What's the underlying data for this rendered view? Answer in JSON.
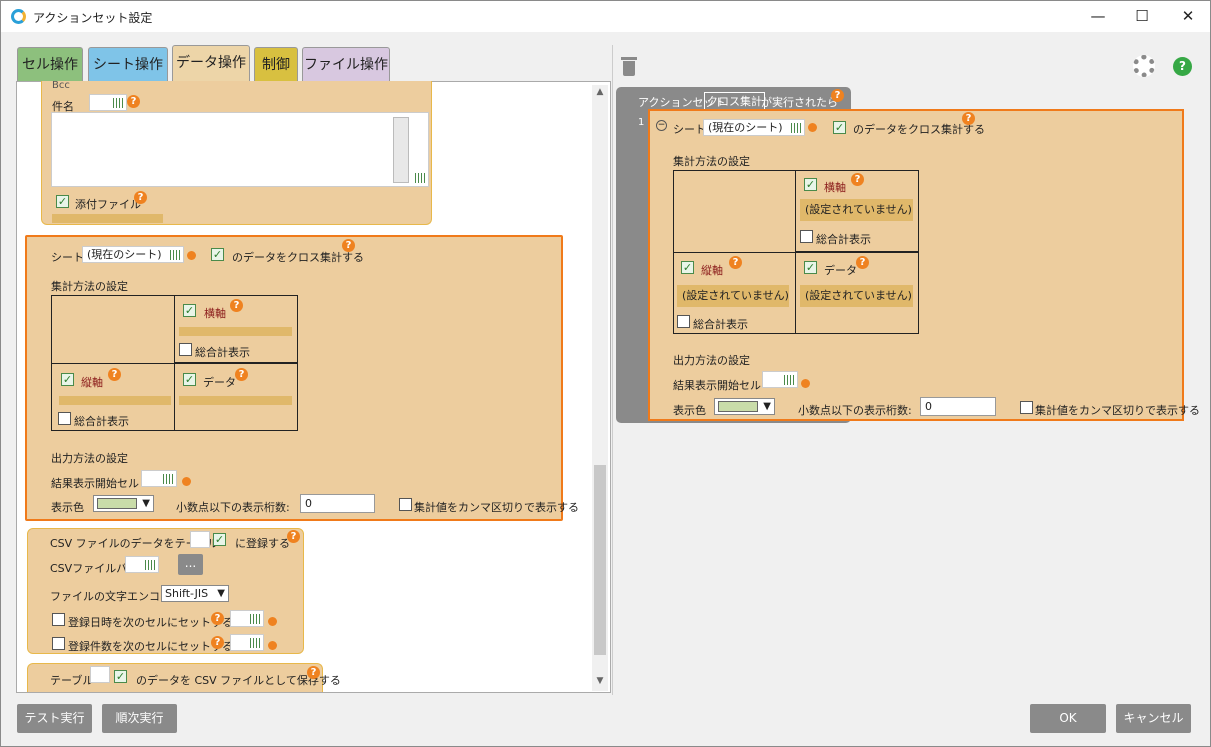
{
  "window": {
    "title": "アクションセット設定",
    "min": "—",
    "max": "☐",
    "close": "✕"
  },
  "tabs": [
    {
      "label": "セル操作",
      "color": "#8dc07d"
    },
    {
      "label": "シート操作",
      "color": "#7fc4e8"
    },
    {
      "label": "データ操作",
      "color": "#edd5a8"
    },
    {
      "label": "制御",
      "color": "#d8c040"
    },
    {
      "label": "ファイル操作",
      "color": "#d8c8e0"
    }
  ],
  "mail": {
    "kenmei": "件名",
    "attach": "添付ファイル",
    "truncated": "Bcc"
  },
  "cross": {
    "sheet_label": "シート",
    "sheet_value": "(現在のシート)",
    "suffix": "のデータをクロス集計する",
    "method": "集計方法の設定",
    "yoko": "横軸",
    "tate": "縦軸",
    "data": "データ",
    "total": "総合計表示",
    "unset": "(設定されていません)",
    "output": "出力方法の設定",
    "start_cell": "結果表示開始セル",
    "color": "表示色",
    "decimals": "小数点以下の表示桁数:",
    "decimal_value": "0",
    "comma": "集計値をカンマ区切りで表示する"
  },
  "csv": {
    "line1a": "CSV ファイルのデータをテーブル",
    "line1b": "に登録する",
    "path": "CSVファイルパス",
    "browse": "...",
    "encode": "ファイルの文字エンコード",
    "encode_value": "Shift-JIS",
    "date": "登録日時を次のセルにセットする",
    "count": "登録件数を次のセルにセットする"
  },
  "save": {
    "label": "テーブル",
    "suffix": "のデータを CSV ファイルとして保存する"
  },
  "right": {
    "header": "アクションセット",
    "header_tag": "クロス集計",
    "header_suffix": "が実行されたら",
    "line_no": "1"
  },
  "buttons": {
    "test": "テスト実行",
    "step": "順次実行",
    "ok": "OK",
    "cancel": "キャンセル"
  },
  "icons": {
    "q": "?",
    "help": "?"
  }
}
